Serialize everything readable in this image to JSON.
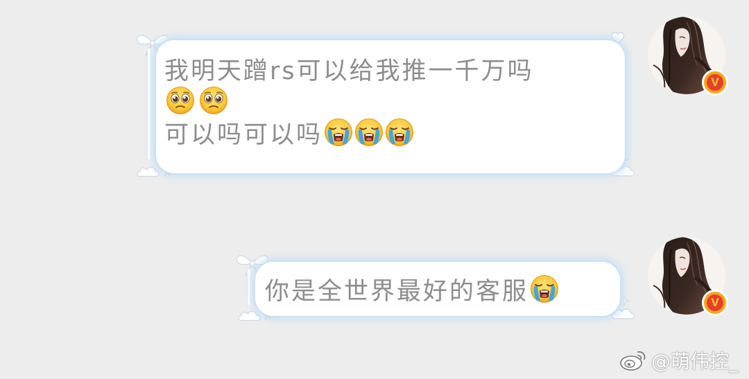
{
  "messages": [
    {
      "lines": [
        "我明天蹭rs可以给我推一千万吗"
      ],
      "emoji_line": [
        "pleading-face",
        "pleading-face"
      ],
      "last_line": "可以吗可以吗",
      "last_line_emojis": [
        "loudly-crying-face",
        "loudly-crying-face",
        "loudly-crying-face"
      ]
    },
    {
      "text": "你是全世界最好的客服",
      "emojis": [
        "loudly-crying-face"
      ]
    }
  ],
  "avatar": {
    "badge_letter": "V",
    "badge_color": "#f3a81f",
    "badge_inner_color": "#e7402a"
  },
  "watermark": {
    "icon": "weibo-logo-icon",
    "text": "@萌伟控_"
  },
  "colors": {
    "background": "#ededed",
    "bubble": "#ffffff",
    "bubble_glow": "#c8e1f5",
    "text": "#8d8d8d"
  }
}
